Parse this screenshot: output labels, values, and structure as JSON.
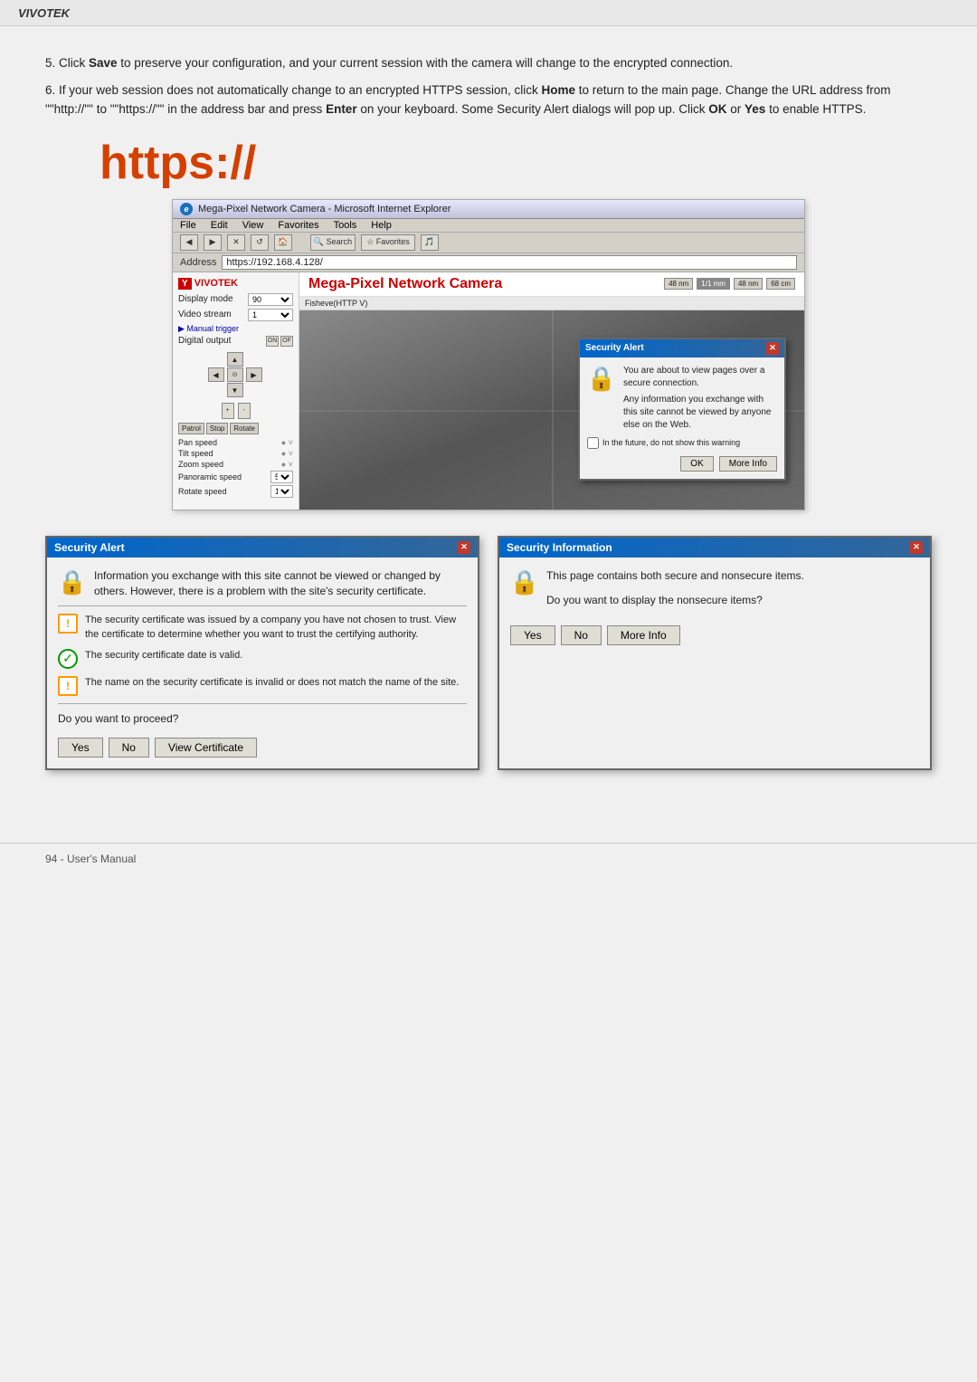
{
  "brand": {
    "name": "VIVOTEK"
  },
  "instructions": {
    "step5": "Click ",
    "step5_bold": "Save",
    "step5_text": " to preserve your configuration, and your current session with the camera will change to the encrypted connection.",
    "step6": "If your web session does not automatically change to an encrypted HTTPS session, click ",
    "step6_bold1": "Home",
    "step6_text1": " to return to the main page. Change the URL address from \"",
    "step6_http": "http://",
    "step6_text2": "\" to \"",
    "step6_https": "https://",
    "step6_text3": "\" in the address bar and press ",
    "step6_bold2": "Enter",
    "step6_text4": " on your keyboard. Some Security Alert dialogs will pop up. Click ",
    "step6_bold3": "OK",
    "step6_text5": " or ",
    "step6_bold4": "Yes",
    "step6_text6": " to enable HTTPS."
  },
  "https_display": "https://",
  "browser": {
    "title": "Mega-Pixel Network Camera - Microsoft Internet Explorer",
    "menu_items": [
      "File",
      "Edit",
      "View",
      "Favorites",
      "Tools",
      "Help"
    ],
    "address_label": "Address",
    "address_value": "https://192.168.4.128/",
    "camera_brand": "VIVOTEK",
    "camera_title": "Mega-Pixel Network Camera",
    "display_mode_label": "Display mode",
    "display_mode_value": "90",
    "video_stream_label": "Video stream",
    "video_stream_value": "1",
    "manual_trigger_label": "Manual trigger",
    "digital_output_label": "Digital output",
    "pan_speed_label": "Pan speed",
    "tilt_speed_label": "Tilt speed",
    "zoom_speed_label": "Zoom speed",
    "panoramic_speed_label": "Panoramic speed",
    "panoramic_speed_value": "5",
    "rotate_speed_label": "Rotate speed",
    "rotate_speed_value": "1",
    "stream_label": "Fisheve(HTTP V)",
    "fps_options": [
      "48 mm",
      "1/1 mm",
      "48 mm",
      "68 cm"
    ],
    "small_alert": {
      "title": "Security Alert",
      "text1": "You are about to view pages over a secure connection.",
      "text2": "Any information you exchange with this site cannot be viewed by anyone else on the Web.",
      "checkbox_text": "In the future, do not show this warning",
      "btn_ok": "OK",
      "btn_more_info": "More Info"
    }
  },
  "security_alert_dialog": {
    "title": "Security Alert",
    "text_main": "Information you exchange with this site cannot be viewed or changed by others. However, there is a problem with the site's security certificate.",
    "cert_items": [
      {
        "type": "warning",
        "text": "The security certificate was issued by a company you have not chosen to trust. View the certificate to determine whether you want to trust the certifying authority."
      },
      {
        "type": "check",
        "text": "The security certificate date is valid."
      },
      {
        "type": "warning",
        "text": "The name on the security certificate is invalid or does not match the name of the site."
      }
    ],
    "question": "Do you want to proceed?",
    "btn_yes": "Yes",
    "btn_no": "No",
    "btn_view_cert": "View Certificate"
  },
  "security_info_dialog": {
    "title": "Security Information",
    "text_main": "This page contains both secure and nonsecure items.",
    "question": "Do you want to display the nonsecure items?",
    "btn_yes": "Yes",
    "btn_no": "No",
    "btn_more_info": "More Info"
  },
  "footer": {
    "text": "94 - User's Manual"
  }
}
